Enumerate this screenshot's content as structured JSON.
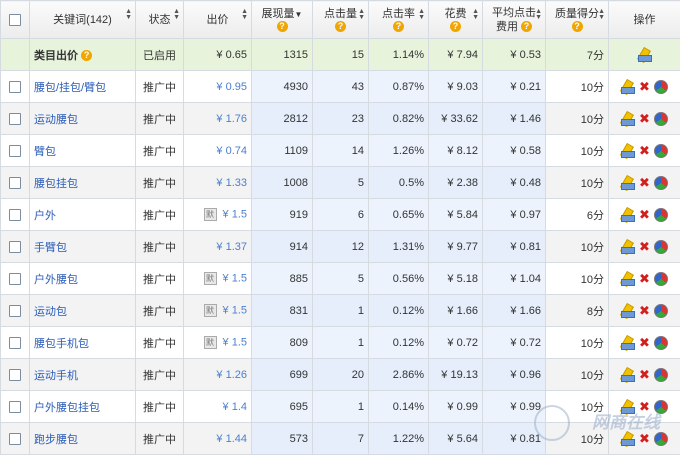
{
  "headers": {
    "keyword": "关键词(142)",
    "status": "状态",
    "bid": "出价",
    "impressions": "展现量",
    "clicks": "点击量",
    "ctr": "点击率",
    "cost": "花费",
    "avg_cpc_line1": "平均点击",
    "avg_cpc_line2": "费用",
    "quality": "质量得分",
    "actions": "操作"
  },
  "category_row": {
    "keyword": "类目出价",
    "status": "已启用",
    "bid": "¥ 0.65",
    "impressions": "1315",
    "clicks": "15",
    "ctr": "1.14%",
    "cost": "¥ 7.94",
    "avg_cpc": "¥ 0.53",
    "quality": "7分"
  },
  "default_tag": "默",
  "rows": [
    {
      "keyword": "腰包/挂包/臂包",
      "status": "推广中",
      "bid": "¥ 0.95",
      "default": false,
      "impressions": "4930",
      "clicks": "43",
      "ctr": "0.87%",
      "cost": "¥ 9.03",
      "avg_cpc": "¥ 0.21",
      "quality": "10分"
    },
    {
      "keyword": "运动腰包",
      "status": "推广中",
      "bid": "¥ 1.76",
      "default": false,
      "impressions": "2812",
      "clicks": "23",
      "ctr": "0.82%",
      "cost": "¥ 33.62",
      "avg_cpc": "¥ 1.46",
      "quality": "10分"
    },
    {
      "keyword": "臂包",
      "status": "推广中",
      "bid": "¥ 0.74",
      "default": false,
      "impressions": "1109",
      "clicks": "14",
      "ctr": "1.26%",
      "cost": "¥ 8.12",
      "avg_cpc": "¥ 0.58",
      "quality": "10分"
    },
    {
      "keyword": "腰包挂包",
      "status": "推广中",
      "bid": "¥ 1.33",
      "default": false,
      "impressions": "1008",
      "clicks": "5",
      "ctr": "0.5%",
      "cost": "¥ 2.38",
      "avg_cpc": "¥ 0.48",
      "quality": "10分"
    },
    {
      "keyword": "户外",
      "status": "推广中",
      "bid": "¥ 1.5",
      "default": true,
      "impressions": "919",
      "clicks": "6",
      "ctr": "0.65%",
      "cost": "¥ 5.84",
      "avg_cpc": "¥ 0.97",
      "quality": "6分"
    },
    {
      "keyword": "手臂包",
      "status": "推广中",
      "bid": "¥ 1.37",
      "default": false,
      "impressions": "914",
      "clicks": "12",
      "ctr": "1.31%",
      "cost": "¥ 9.77",
      "avg_cpc": "¥ 0.81",
      "quality": "10分"
    },
    {
      "keyword": "户外腰包",
      "status": "推广中",
      "bid": "¥ 1.5",
      "default": true,
      "impressions": "885",
      "clicks": "5",
      "ctr": "0.56%",
      "cost": "¥ 5.18",
      "avg_cpc": "¥ 1.04",
      "quality": "10分"
    },
    {
      "keyword": "运动包",
      "status": "推广中",
      "bid": "¥ 1.5",
      "default": true,
      "impressions": "831",
      "clicks": "1",
      "ctr": "0.12%",
      "cost": "¥ 1.66",
      "avg_cpc": "¥ 1.66",
      "quality": "8分"
    },
    {
      "keyword": "腰包手机包",
      "status": "推广中",
      "bid": "¥ 1.5",
      "default": true,
      "impressions": "809",
      "clicks": "1",
      "ctr": "0.12%",
      "cost": "¥ 0.72",
      "avg_cpc": "¥ 0.72",
      "quality": "10分"
    },
    {
      "keyword": "运动手机",
      "status": "推广中",
      "bid": "¥ 1.26",
      "default": false,
      "impressions": "699",
      "clicks": "20",
      "ctr": "2.86%",
      "cost": "¥ 19.13",
      "avg_cpc": "¥ 0.96",
      "quality": "10分"
    },
    {
      "keyword": "户外腰包挂包",
      "status": "推广中",
      "bid": "¥ 1.4",
      "default": false,
      "impressions": "695",
      "clicks": "1",
      "ctr": "0.14%",
      "cost": "¥ 0.99",
      "avg_cpc": "¥ 0.99",
      "quality": "10分"
    },
    {
      "keyword": "跑步腰包",
      "status": "推广中",
      "bid": "¥ 1.44",
      "default": false,
      "impressions": "573",
      "clicks": "7",
      "ctr": "1.22%",
      "cost": "¥ 5.64",
      "avg_cpc": "¥ 0.81",
      "quality": "10分"
    }
  ],
  "watermark": "网商在线",
  "icons": [
    "help-icon",
    "edit-icon",
    "delete-icon",
    "report-chart-icon",
    "sort-icon"
  ],
  "colors": {
    "link": "#2a5cb8",
    "category_row_bg": "#e8f3dc",
    "metric_col_bg": "#edf3fc",
    "delete": "#d21e1e"
  }
}
